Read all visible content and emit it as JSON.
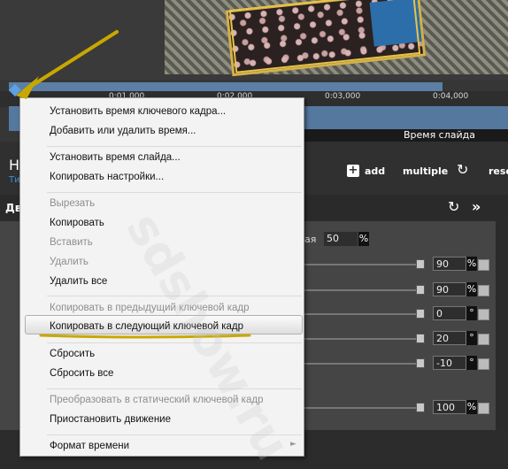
{
  "timeline": {
    "ticks": [
      "0:01,000",
      "0:02,000",
      "0:03,000",
      "0:04,000"
    ],
    "slide_time_label": "Время слайда"
  },
  "toolbar": {
    "title": "Н",
    "subtitle": "Ти",
    "add_label": "add",
    "multiple_label": "multiple",
    "reset_label": "rese"
  },
  "panel": {
    "title": "Дв",
    "opacity_label": "ая",
    "opacity_value": "50",
    "opacity_unit": "%",
    "rows": [
      {
        "value": "90",
        "unit": "%"
      },
      {
        "value": "90",
        "unit": "%"
      },
      {
        "value": "0",
        "unit": "°"
      },
      {
        "value": "20",
        "unit": "°"
      },
      {
        "value": "-10",
        "unit": "°"
      },
      {
        "value": "100",
        "unit": "%"
      }
    ]
  },
  "menu": {
    "items": [
      {
        "label": "Установить время ключевого кадра...",
        "enabled": true
      },
      {
        "label": "Добавить или удалить время...",
        "enabled": true
      },
      {
        "label": "Установить время слайда...",
        "enabled": true
      },
      {
        "label": "Копировать настройки...",
        "enabled": true
      },
      {
        "label": "Вырезать",
        "enabled": false
      },
      {
        "label": "Копировать",
        "enabled": true
      },
      {
        "label": "Вставить",
        "enabled": false
      },
      {
        "label": "Удалить",
        "enabled": false
      },
      {
        "label": "Удалить все",
        "enabled": true
      },
      {
        "label": "Копировать в предыдущий ключевой кадр",
        "enabled": false
      },
      {
        "label": "Копировать в следующий ключевой кадр",
        "enabled": true,
        "highlighted": true
      },
      {
        "label": "Сбросить",
        "enabled": true
      },
      {
        "label": "Сбросить все",
        "enabled": true
      },
      {
        "label": "Преобразовать в статический ключевой кадр",
        "enabled": false
      },
      {
        "label": "Приостановить движение",
        "enabled": true
      },
      {
        "label": "Формат времени",
        "enabled": true
      }
    ]
  },
  "watermark": "sdshow.ru",
  "colors": {
    "annotation": "#c8a800",
    "timeline_blue": "#55789f",
    "menu_bg": "#f3f3f3"
  }
}
